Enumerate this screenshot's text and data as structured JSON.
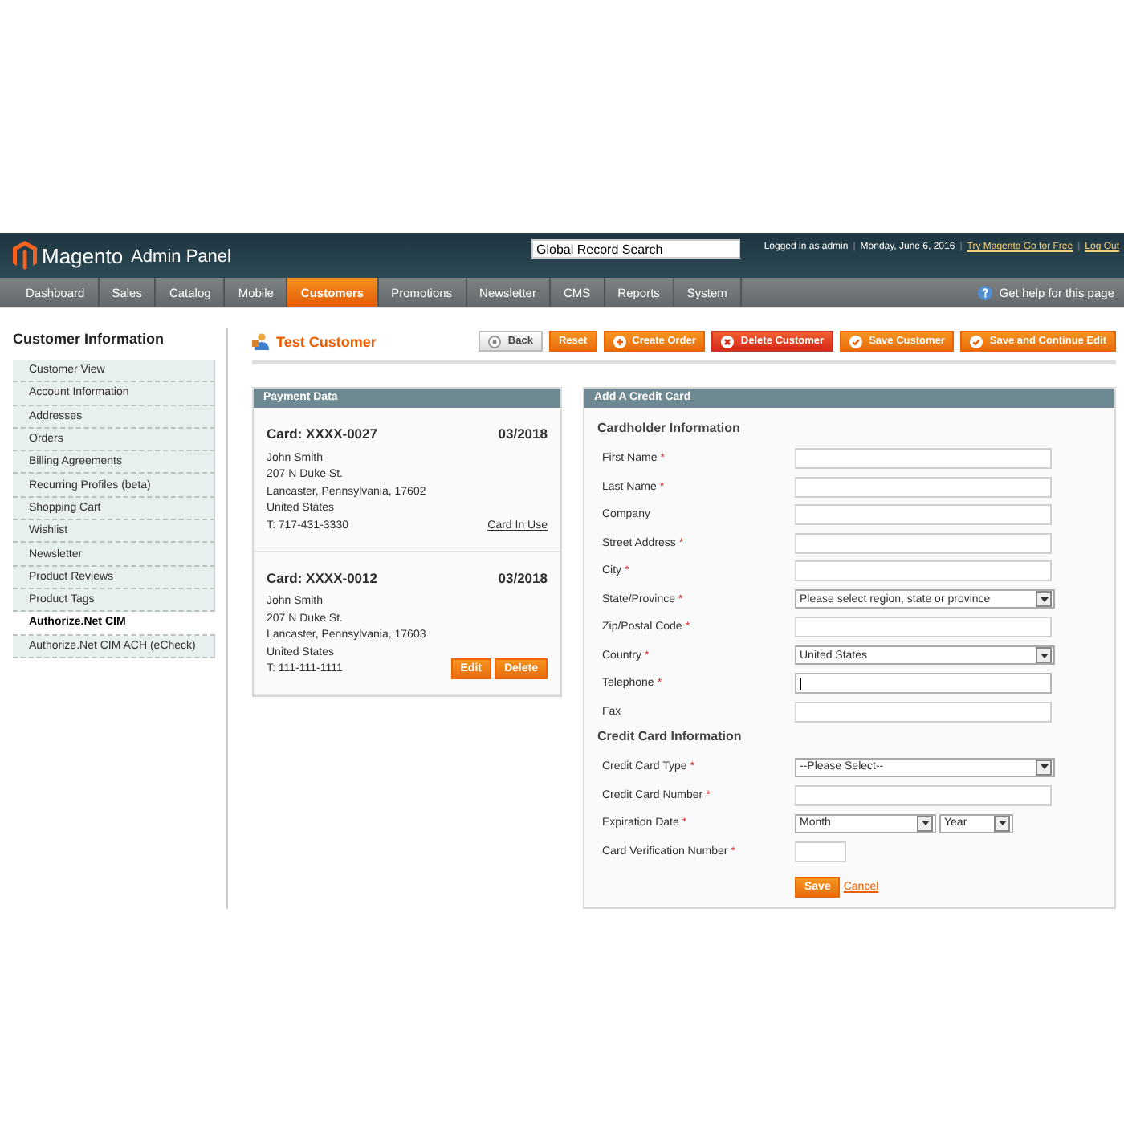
{
  "header": {
    "logo_word": "Magento",
    "logo_suffix": "Admin Panel",
    "search": {
      "value": "Global Record Search"
    },
    "user_info": "Logged in as admin",
    "separator": "|",
    "date": "Monday, June 6, 2016",
    "links": [
      "Try Magento Go for Free",
      "Log Out"
    ]
  },
  "nav": {
    "items": [
      {
        "label": "Dashboard",
        "selected": false
      },
      {
        "label": "Sales",
        "selected": false
      },
      {
        "label": "Catalog",
        "selected": false
      },
      {
        "label": "Mobile",
        "selected": false
      },
      {
        "label": "Customers",
        "selected": true
      },
      {
        "label": "Promotions",
        "selected": false
      },
      {
        "label": "Newsletter",
        "selected": false
      },
      {
        "label": "CMS",
        "selected": false
      },
      {
        "label": "Reports",
        "selected": false
      },
      {
        "label": "System",
        "selected": false
      }
    ],
    "help": "Get help for this page"
  },
  "sidebar": {
    "title": "Customer Information",
    "items": [
      {
        "label": "Customer View",
        "selected": false
      },
      {
        "label": "Account Information",
        "selected": false
      },
      {
        "label": "Addresses",
        "selected": false
      },
      {
        "label": "Orders",
        "selected": false
      },
      {
        "label": "Billing Agreements",
        "selected": false
      },
      {
        "label": "Recurring Profiles (beta)",
        "selected": false
      },
      {
        "label": "Shopping Cart",
        "selected": false
      },
      {
        "label": "Wishlist",
        "selected": false
      },
      {
        "label": "Newsletter",
        "selected": false
      },
      {
        "label": "Product Reviews",
        "selected": false
      },
      {
        "label": "Product Tags",
        "selected": false
      },
      {
        "label": "Authorize.Net CIM",
        "selected": true
      },
      {
        "label": "Authorize.Net CIM ACH (eCheck)",
        "selected": false
      }
    ]
  },
  "page_title": "Test Customer",
  "buttons": [
    {
      "label": "Back",
      "kind": "back"
    },
    {
      "label": "Reset",
      "kind": "plain"
    },
    {
      "label": "Create Order",
      "kind": "add"
    },
    {
      "label": "Delete Customer",
      "kind": "delete"
    },
    {
      "label": "Save Customer",
      "kind": "save"
    },
    {
      "label": "Save and Continue Edit",
      "kind": "save"
    }
  ],
  "payment_data": {
    "title": "Payment Data",
    "cards": [
      {
        "title": "Card: XXXX-0027",
        "expiry": "03/2018",
        "lines": [
          "John Smith",
          "207 N Duke St.",
          "Lancaster, Pennsylvania, 17602",
          "United States",
          "T: 717-431-3330"
        ],
        "in_use": "Card In Use"
      },
      {
        "title": "Card: XXXX-0012",
        "expiry": "03/2018",
        "lines": [
          "John Smith",
          "207 N Duke St.",
          "Lancaster, Pennsylvania, 17603",
          "United States",
          "T: 111-111-1111"
        ],
        "actions": [
          "Edit",
          "Delete"
        ]
      }
    ]
  },
  "add_card": {
    "title": "Add A Credit Card",
    "required_mark": "*",
    "sections": [
      {
        "heading": "Cardholder Information",
        "fields": [
          {
            "label": "First Name",
            "required": true,
            "kind": "text"
          },
          {
            "label": "Last Name",
            "required": true,
            "kind": "text"
          },
          {
            "label": "Company",
            "required": false,
            "kind": "text"
          },
          {
            "label": "Street Address",
            "required": true,
            "kind": "text"
          },
          {
            "label": "City",
            "required": true,
            "kind": "text"
          },
          {
            "label": "State/Province",
            "required": true,
            "kind": "select",
            "value": "Please select region, state or province"
          },
          {
            "label": "Zip/Postal Code",
            "required": true,
            "kind": "text"
          },
          {
            "label": "Country",
            "required": true,
            "kind": "select",
            "value": "United States"
          },
          {
            "label": "Telephone",
            "required": true,
            "kind": "text",
            "focused": true
          },
          {
            "label": "Fax",
            "required": false,
            "kind": "text"
          }
        ]
      },
      {
        "heading": "Credit Card Information",
        "fields": [
          {
            "label": "Credit Card Type",
            "required": true,
            "kind": "select",
            "value": "--Please Select--"
          },
          {
            "label": "Credit Card Number",
            "required": true,
            "kind": "text"
          },
          {
            "label": "Expiration Date",
            "required": true,
            "kind": "expiry",
            "month": "Month",
            "year": "Year"
          },
          {
            "label": "Card Verification Number",
            "required": true,
            "kind": "short"
          }
        ]
      }
    ],
    "save": "Save",
    "cancel": "Cancel"
  }
}
